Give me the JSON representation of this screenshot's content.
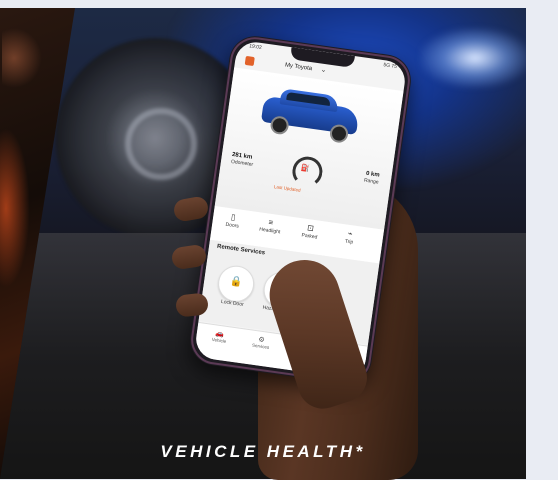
{
  "app": {
    "vehicle_name": "My Toyota",
    "status_time": "19:02",
    "status_icons": "5G 75",
    "odometer_value": "281 km",
    "odometer_label": "Odometer",
    "range_value": "0 km",
    "range_label": "Range",
    "update_text": "Last Updated",
    "quick_actions": [
      "Doors",
      "Headlight",
      "Parked",
      "Trip"
    ],
    "remote_title": "Remote Services",
    "remote_buttons": [
      "Lock Door",
      "Hazard Lights"
    ],
    "nav_items": [
      "Vehicle",
      "Services"
    ]
  },
  "headline": "VEHICLE HEALTH*",
  "colors": {
    "accent": "#e2622a",
    "car_blue": "#2a5fd0"
  },
  "icons": [
    "app-logo-icon",
    "chevron-down-icon",
    "fuel-gauge-icon",
    "door-icon",
    "headlight-icon",
    "parking-icon",
    "trip-icon",
    "lock-icon",
    "hazard-icon",
    "car-nav-icon",
    "services-nav-icon"
  ]
}
